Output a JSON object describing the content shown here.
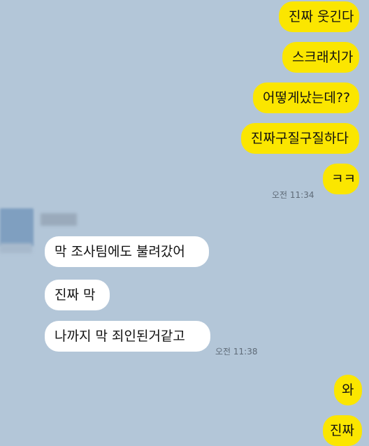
{
  "messages": {
    "out1": "진짜 웃긴다",
    "out2": "스크래치가",
    "out3": "어떻게났는데??",
    "out4": "진짜구질구질하다",
    "out5": "ㅋㅋ",
    "out_time": "오전 11:34",
    "in1": "막 조사팀에도 불려갔어",
    "in2": "진짜 막",
    "in3": "나까지 막 죄인된거같고",
    "in_time": "오전 11:38",
    "out6": "와",
    "out7": "진짜"
  },
  "colors": {
    "background": "#b3c6d8",
    "outgoing_bubble": "#fbe600",
    "incoming_bubble": "#ffffff"
  }
}
